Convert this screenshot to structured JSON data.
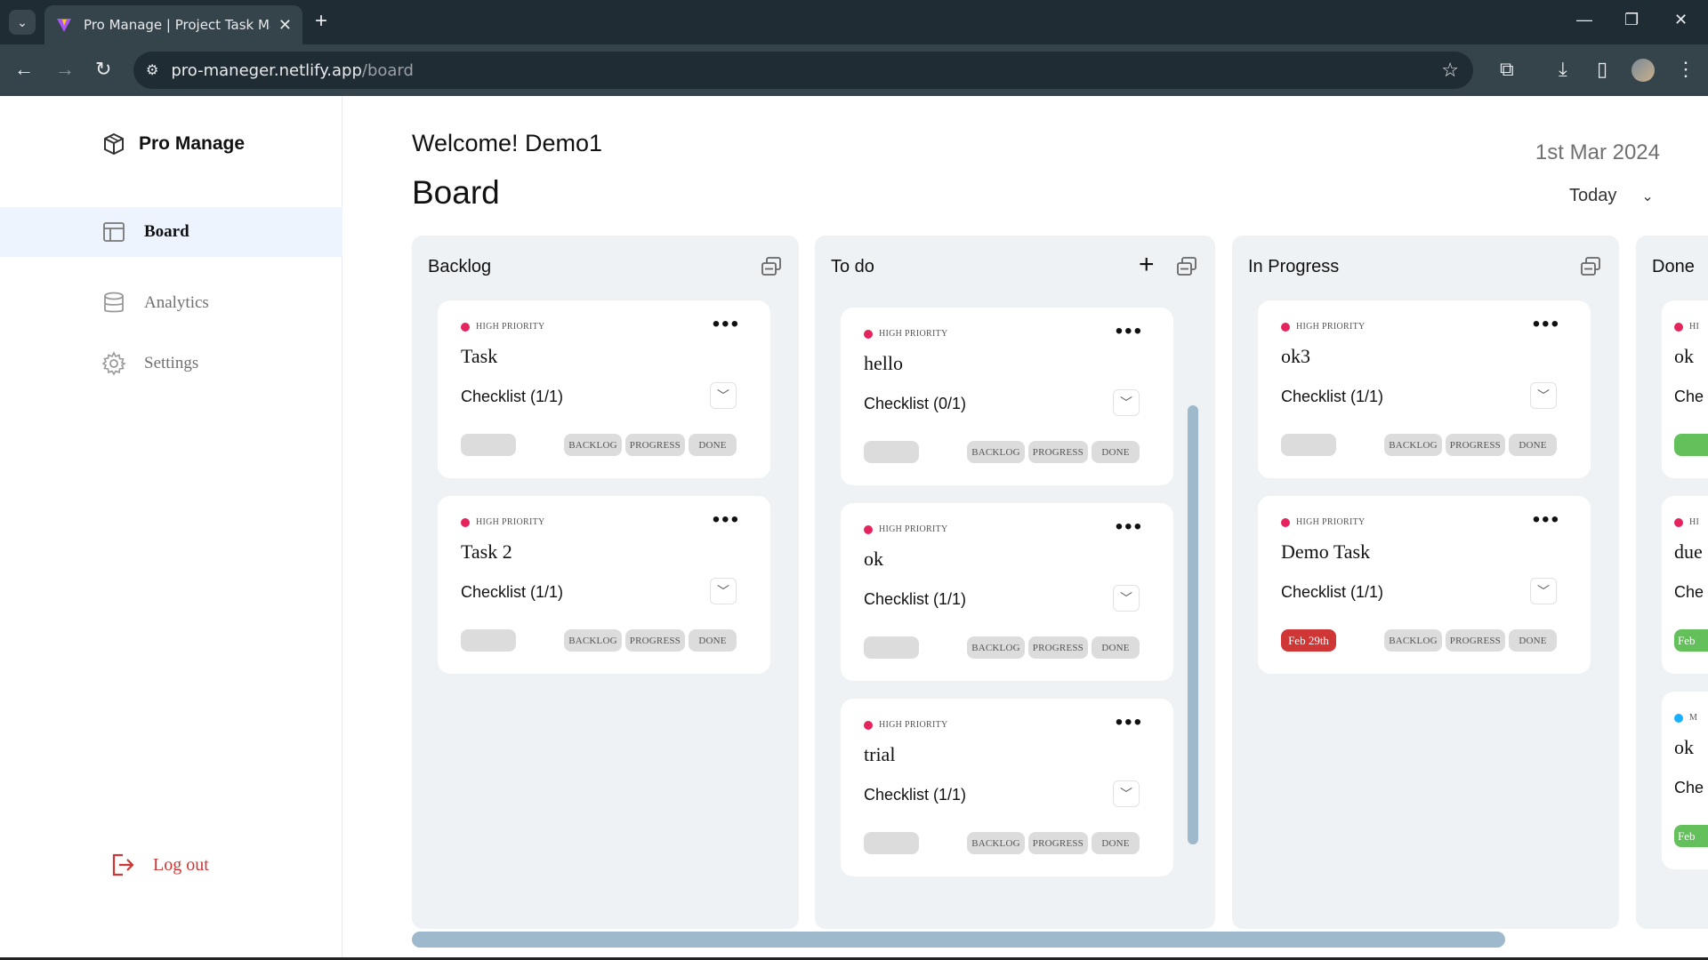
{
  "browser": {
    "tab_title": "Pro Manage | Project Task Manager",
    "url_host": "pro-maneger.netlify.app",
    "url_path": "/board"
  },
  "sidebar": {
    "brand": "Pro Manage",
    "items": [
      {
        "label": "Board",
        "icon": "board-icon"
      },
      {
        "label": "Analytics",
        "icon": "database-icon"
      },
      {
        "label": "Settings",
        "icon": "gear-icon"
      }
    ],
    "logout_label": "Log out"
  },
  "header": {
    "welcome": "Welcome! Demo1",
    "title": "Board",
    "date": "1st Mar 2024",
    "filter": "Today"
  },
  "columns": [
    {
      "title": "Backlog",
      "cards": [
        {
          "priority": "HIGH PRIORITY",
          "title": "Task",
          "checklist": "Checklist (1/1)",
          "due": "",
          "actions": [
            "BACKLOG",
            "PROGRESS",
            "DONE"
          ]
        },
        {
          "priority": "HIGH PRIORITY",
          "title": "Task 2",
          "checklist": "Checklist (1/1)",
          "due": "",
          "actions": [
            "BACKLOG",
            "PROGRESS",
            "DONE"
          ]
        }
      ]
    },
    {
      "title": "To do",
      "cards": [
        {
          "priority": "HIGH PRIORITY",
          "title": "hello",
          "checklist": "Checklist (0/1)",
          "due": "",
          "actions": [
            "BACKLOG",
            "PROGRESS",
            "DONE"
          ]
        },
        {
          "priority": "HIGH PRIORITY",
          "title": "ok",
          "checklist": "Checklist (1/1)",
          "due": "",
          "actions": [
            "BACKLOG",
            "PROGRESS",
            "DONE"
          ]
        },
        {
          "priority": "HIGH PRIORITY",
          "title": "trial",
          "checklist": "Checklist (1/1)",
          "due": "",
          "actions": [
            "BACKLOG",
            "PROGRESS",
            "DONE"
          ]
        }
      ]
    },
    {
      "title": "In Progress",
      "cards": [
        {
          "priority": "HIGH PRIORITY",
          "title": "ok3",
          "checklist": "Checklist (1/1)",
          "due": "",
          "actions": [
            "BACKLOG",
            "PROGRESS",
            "DONE"
          ]
        },
        {
          "priority": "HIGH PRIORITY",
          "title": "Demo Task",
          "checklist": "Checklist (1/1)",
          "due": "Feb 29th",
          "actions": [
            "BACKLOG",
            "PROGRESS",
            "DONE"
          ]
        }
      ]
    },
    {
      "title": "Done",
      "cards": [
        {
          "priority": "HI",
          "title": "ok",
          "checklist": "Che",
          "due": ""
        },
        {
          "priority": "HI",
          "title": "due",
          "checklist": "Che",
          "due": "Feb"
        },
        {
          "priority": "M",
          "title": "ok",
          "checklist": "Che",
          "due": "Feb"
        }
      ]
    }
  ],
  "colors": {
    "priority_high": "#e5245e",
    "priority_moderate": "#18b0ff",
    "due_overdue": "#cf3636",
    "due_done": "#63c05b",
    "column_bg": "#eef2f5",
    "active_nav_bg": "#edf4fe"
  }
}
